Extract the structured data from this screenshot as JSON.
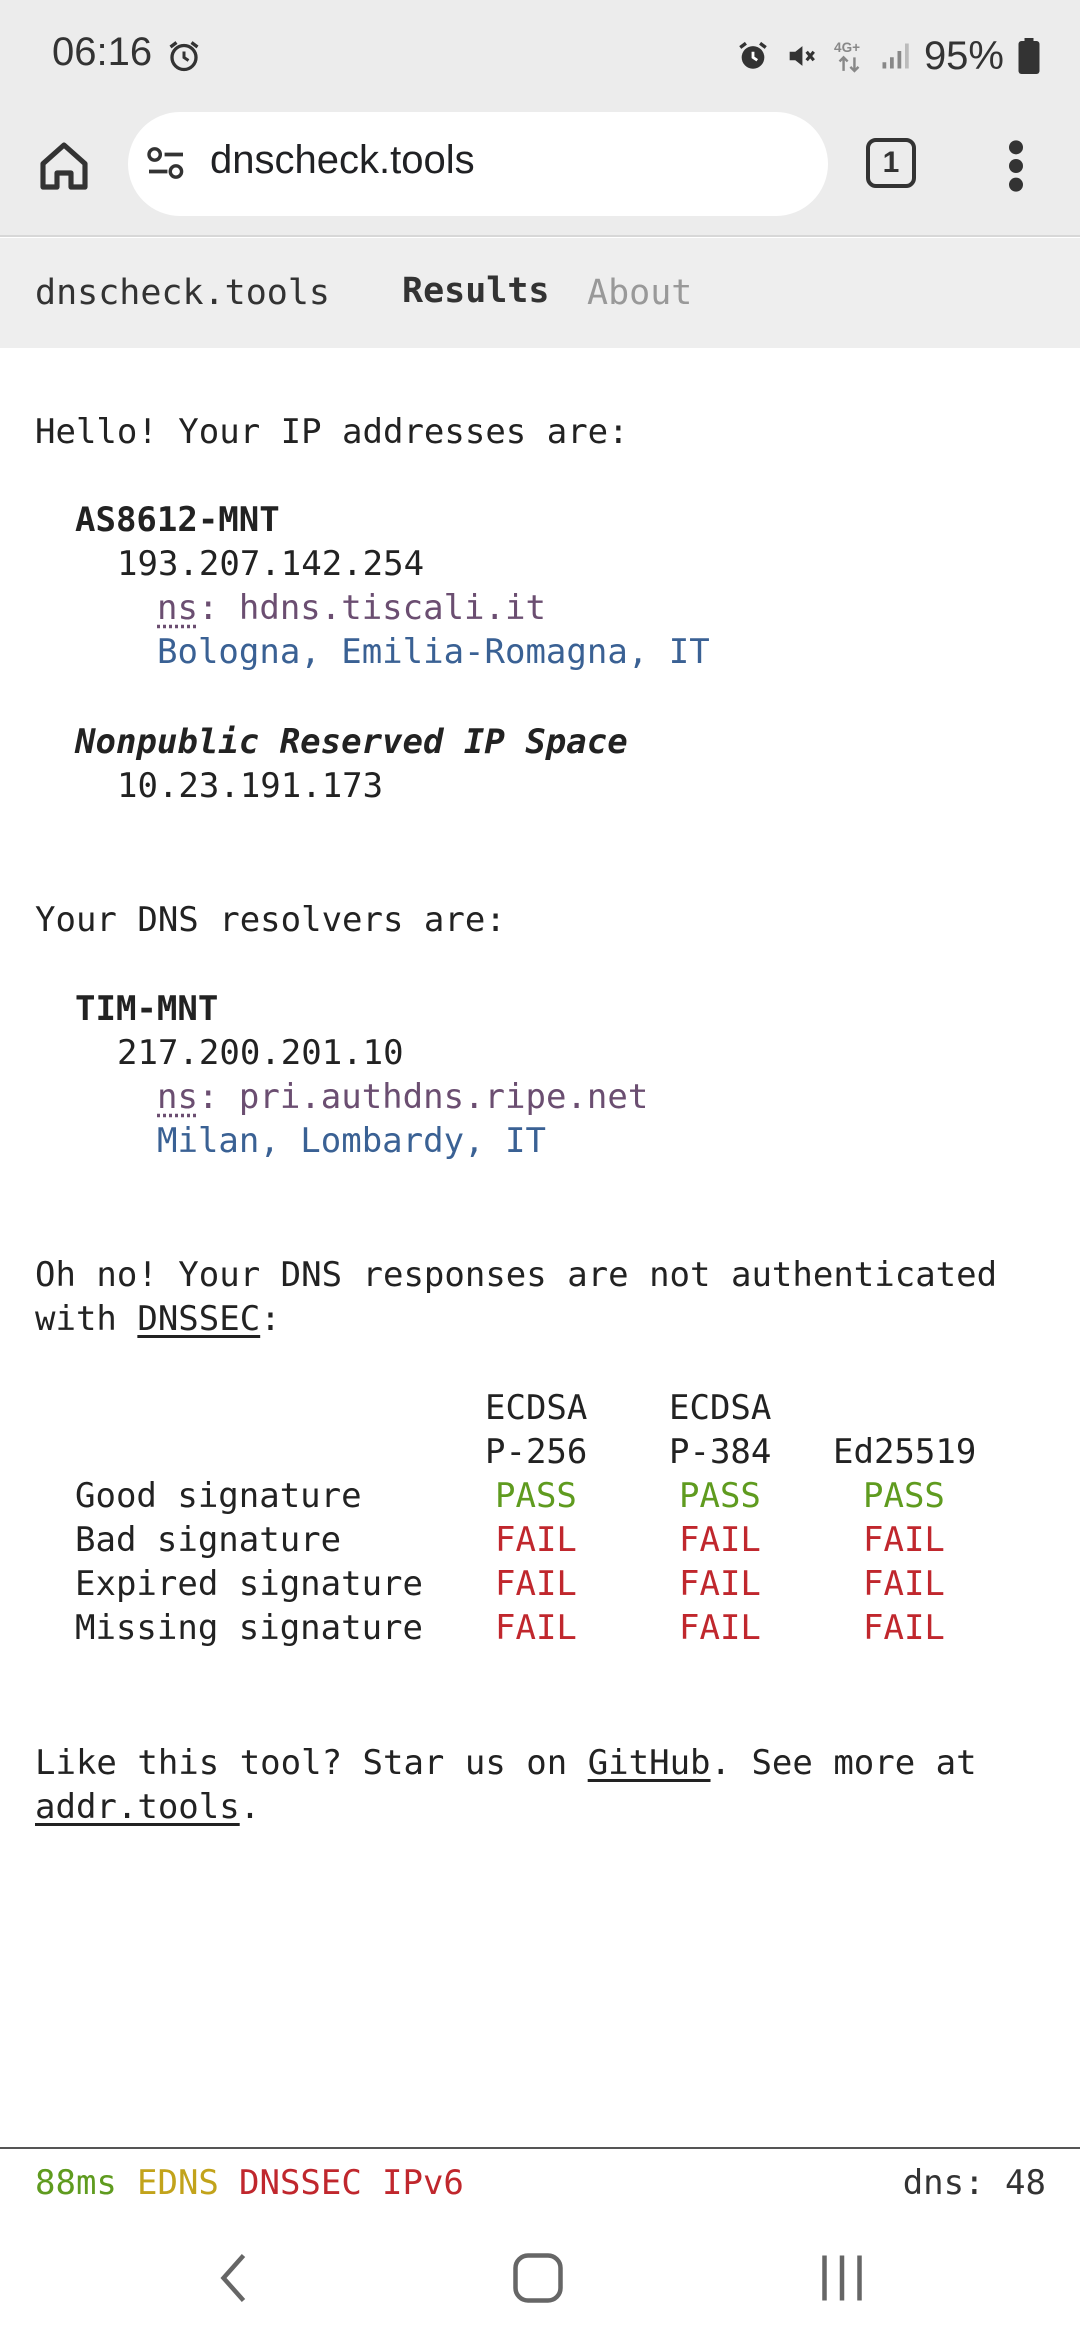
{
  "status_bar": {
    "time": "06:16",
    "battery": "95%",
    "icons": [
      "alarm-icon",
      "alarm-icon",
      "mute-icon",
      "network-4g-icon",
      "signal-icon",
      "battery-icon"
    ]
  },
  "browser": {
    "url": "dnscheck.tools",
    "tab_count": "1"
  },
  "site_nav": {
    "brand": "dnscheck.tools",
    "results": "Results",
    "about": "About"
  },
  "ip_section": {
    "heading": "Hello! Your IP addresses are:",
    "entries": [
      {
        "name": "AS8612-MNT",
        "ip": "193.207.142.254",
        "ns_label": "ns",
        "ns": ": hdns.tiscali.it",
        "location": "Bologna, Emilia-Romagna, IT"
      },
      {
        "name": "Nonpublic Reserved IP Space",
        "ip": "10.23.191.173"
      }
    ]
  },
  "resolver_section": {
    "heading": "Your DNS resolvers are:",
    "entries": [
      {
        "name": "TIM-MNT",
        "ip": "217.200.201.10",
        "ns_label": "ns",
        "ns": ": pri.authdns.ripe.net",
        "location": "Milan, Lombardy, IT"
      }
    ]
  },
  "dnssec_section": {
    "line1": "Oh no! Your DNS responses are not authenticated",
    "line2_prefix": "with ",
    "link": "DNSSEC",
    "line2_suffix": ":",
    "columns": [
      {
        "top": "ECDSA",
        "bottom": "P-256"
      },
      {
        "top": "ECDSA",
        "bottom": "P-384"
      },
      {
        "top": "",
        "bottom": "Ed25519"
      }
    ],
    "rows": [
      {
        "label": "Good signature",
        "results": [
          "PASS",
          "PASS",
          "PASS"
        ]
      },
      {
        "label": "Bad signature",
        "results": [
          "FAIL",
          "FAIL",
          "FAIL"
        ]
      },
      {
        "label": "Expired signature",
        "results": [
          "FAIL",
          "FAIL",
          "FAIL"
        ]
      },
      {
        "label": "Missing signature",
        "results": [
          "FAIL",
          "FAIL",
          "FAIL"
        ]
      }
    ]
  },
  "footer_text": {
    "prefix": "Like this tool? Star us on ",
    "github": "GitHub",
    "middle": ". See more at",
    "addr": "addr.tools",
    "suffix": "."
  },
  "status_footer": {
    "latency": "88ms",
    "edns": "EDNS",
    "dnssec": "DNSSEC",
    "ipv6": "IPv6",
    "dns_count": "dns: 48"
  },
  "colors": {
    "pass": "#5f9b1f",
    "fail": "#c0272d",
    "edns": "#c2a31b",
    "ns": "#6b4e71",
    "location": "#3a6194"
  }
}
